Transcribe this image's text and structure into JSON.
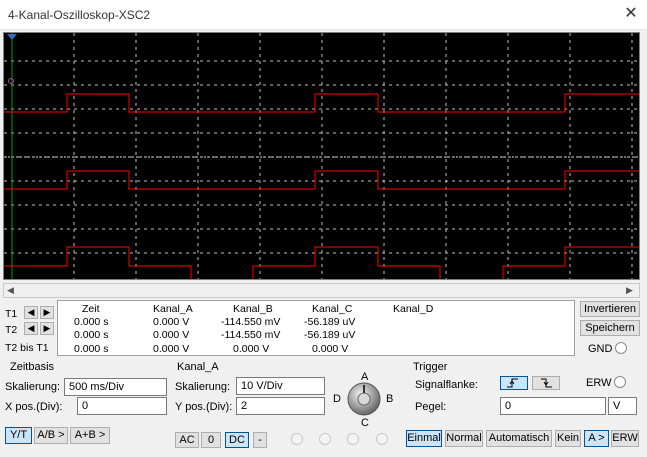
{
  "window": {
    "title": "4-Kanal-Oszilloskop-XSC2"
  },
  "colors": {
    "trace": "#ff0000",
    "grid": "#c0c0c0",
    "background": "#000000",
    "cursor": "#00a000"
  },
  "readout": {
    "rows": [
      "T1",
      "T2",
      "T2 bis T1"
    ],
    "headers": [
      "Zeit",
      "Kanal_A",
      "Kanal_B",
      "Kanal_C",
      "Kanal_D"
    ],
    "values": [
      [
        "0.000 s",
        "0.000 V",
        "-114.550 mV",
        "-56.189 uV",
        ""
      ],
      [
        "0.000 s",
        "0.000 V",
        "-114.550 mV",
        "-56.189 uV",
        ""
      ],
      [
        "0.000 s",
        "0.000 V",
        "0.000 V",
        "0.000 V",
        ""
      ]
    ]
  },
  "side": {
    "invert": "Invertieren",
    "save": "Speichern",
    "gnd": "GND"
  },
  "zeitbasis": {
    "title": "Zeitbasis",
    "scale_label": "Skalierung:",
    "scale_value": "500 ms/Div",
    "xpos_label": "X pos.(Div):",
    "xpos_value": "0",
    "modes": [
      "Y/T",
      "A/B >",
      "A+B >"
    ]
  },
  "kanal": {
    "title": "Kanal_A",
    "scale_label": "Skalierung:",
    "scale_value": "10  V/Div",
    "ypos_label": "Y pos.(Div):",
    "ypos_value": "2",
    "couplings": [
      "AC",
      "0",
      "DC",
      "-"
    ],
    "knob_labels": {
      "a": "A",
      "b": "B",
      "c": "C",
      "d": "D"
    }
  },
  "trigger": {
    "title": "Trigger",
    "edge_label": "Signalflanke:",
    "erw": "ERW",
    "level_label": "Pegel:",
    "level_value": "0",
    "level_unit": "V",
    "modes": [
      "Einmal",
      "Normal",
      "Automatisch",
      "Kein",
      "A >",
      "ERW"
    ]
  },
  "traces": [
    {
      "name": "A",
      "low": 79,
      "high": 61,
      "pattern": [
        0,
        1,
        0,
        0,
        1,
        0,
        0,
        1
      ]
    },
    {
      "name": "B",
      "low": 156,
      "high": 138,
      "pattern": [
        0,
        1,
        0,
        0,
        1,
        0,
        0,
        1
      ]
    },
    {
      "name": "C",
      "low": 233,
      "high": 214,
      "low2": 252,
      "pattern": [
        0,
        1,
        0,
        -1,
        1,
        0,
        -1,
        1
      ]
    }
  ]
}
